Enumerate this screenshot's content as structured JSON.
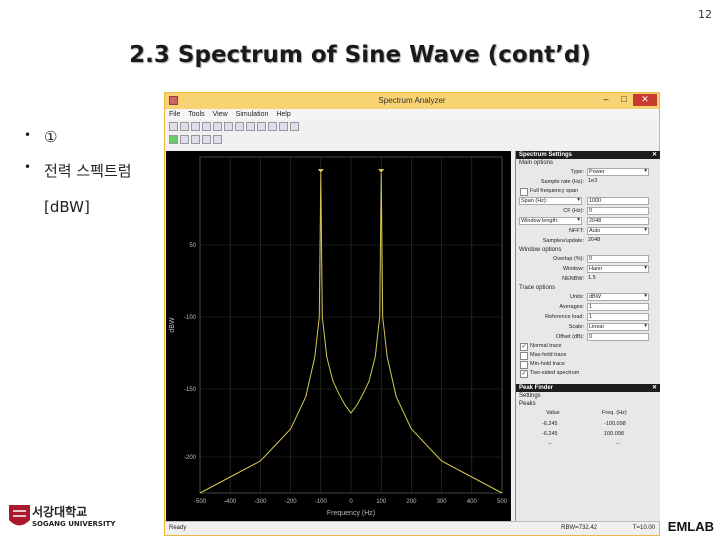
{
  "slide": {
    "page_number": "12",
    "title": "2.3 Spectrum of Sine Wave (cont’d)",
    "bullets": [
      "①",
      "전력 스펙트럼"
    ],
    "subtext": "[dBW]",
    "logo_text_kr": "서강대학교",
    "logo_text_en": "SOGANG UNIVERSITY",
    "footer": "EMLAB"
  },
  "window": {
    "title": "Spectrum Analyzer",
    "menu": [
      "File",
      "Tools",
      "View",
      "Simulation",
      "Help"
    ],
    "status_left": "Ready",
    "status_rbw": "RBW=732.42",
    "status_time": "T=10.00"
  },
  "plot": {
    "ylabel": "dBW",
    "xlabel": "Frequency (Hz)",
    "yticks": [
      "50",
      "-100",
      "-150",
      "-200"
    ],
    "xticks": [
      "-500",
      "-400",
      "-300",
      "-200",
      "-100",
      "0",
      "100",
      "200",
      "300",
      "400",
      "500"
    ]
  },
  "chart_data": {
    "type": "line",
    "xlabel": "Frequency (Hz)",
    "ylabel": "dBW",
    "series": [
      {
        "color": "#d4c850",
        "x": [
          -500,
          -400,
          -300,
          -250,
          -200,
          -150,
          -120,
          -105,
          -100,
          -95,
          -80,
          -60,
          -40,
          -20,
          0,
          20,
          40,
          60,
          80,
          95,
          100,
          105,
          120,
          150,
          200,
          250,
          300,
          400,
          500
        ],
        "values": [
          -210,
          -200,
          -190,
          -180,
          -170,
          -150,
          -125,
          -100,
          -10,
          -100,
          -125,
          -140,
          -148,
          -155,
          -160,
          -155,
          -148,
          -140,
          -125,
          -100,
          -10,
          -100,
          -125,
          -150,
          -170,
          -180,
          -190,
          -200,
          -210
        ]
      }
    ],
    "peak_markers_x": [
      -100,
      100
    ],
    "grid": true
  },
  "settings": {
    "header": "Spectrum Settings",
    "main_options": "Main options",
    "type_label": "Type:",
    "type_value": "Power",
    "sample_rate_label": "Sample rate (Hz):",
    "sample_rate_value": "1e3",
    "full_freq_span": "Full frequency span",
    "span_label": "Span (Hz):",
    "span_value": "1000",
    "cf_label": "CF (Hz):",
    "cf_value": "0",
    "window_length_label": "Window length:",
    "window_length_value": "2048",
    "nfft_label": "NFFT:",
    "nfft_value": "Auto",
    "samples_label": "Samples/update:",
    "samples_value": "2048",
    "window_options": "Window options",
    "overlap_label": "Overlap (%):",
    "overlap_value": "0",
    "window_label": "Window:",
    "window_value": "Hann",
    "nenbw_label": "NENBW:",
    "nenbw_value": "1.5",
    "trace_options": "Trace options",
    "units_label": "Units:",
    "units_value": "dBW",
    "averages_label": "Averages:",
    "averages_value": "1",
    "ref_load_label": "Reference load:",
    "ref_load_value": "1",
    "scale_label": "Scale:",
    "scale_value": "Linear",
    "offset_label": "Offset (dB):",
    "offset_value": "0",
    "normal_trace": "Normal trace",
    "max_hold": "Max-hold trace",
    "min_hold": "Min-hold trace",
    "two_sided": "Two-sided spectrum"
  },
  "peak_finder": {
    "header": "Peak Finder",
    "settings": "Settings",
    "peaks": "Peaks",
    "value_col": "Value",
    "freq_col": "Freq. (Hz)",
    "rows": [
      {
        "value": "-6.245",
        "freq": "-100.098"
      },
      {
        "value": "-6.245",
        "freq": "100.098"
      },
      {
        "value": "--",
        "freq": "--"
      }
    ]
  }
}
